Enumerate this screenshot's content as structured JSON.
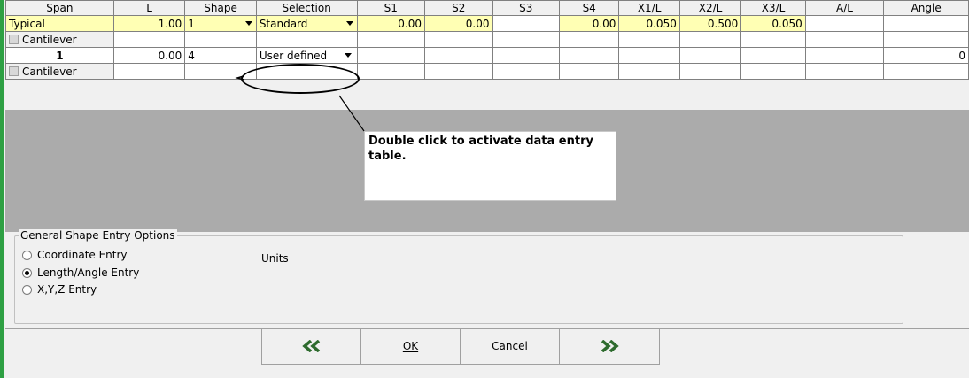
{
  "columns": [
    "Span",
    "L",
    "Shape",
    "Selection",
    "S1",
    "S2",
    "S3",
    "S4",
    "X1/L",
    "X2/L",
    "X3/L",
    "A/L",
    "Angle"
  ],
  "rows": {
    "typical": {
      "span": "Typical",
      "l": "1.00",
      "shape": "1",
      "selection": "Standard",
      "s1": "0.00",
      "s2": "0.00",
      "s3": "",
      "s4": "0.00",
      "x1": "0.050",
      "x2": "0.500",
      "x3": "0.050",
      "a": "",
      "angle": ""
    },
    "cant1": {
      "label": "Cantilever"
    },
    "span1": {
      "span": "1",
      "l": "0.00",
      "shape": "4",
      "selection": "User defined",
      "angle": "0"
    },
    "cant2": {
      "label": "Cantilever"
    }
  },
  "callout": {
    "text": "Double click to activate data entry table."
  },
  "options": {
    "legend": "General Shape Entry Options",
    "coordinate": "Coordinate Entry",
    "length_angle": "Length/Angle Entry",
    "xyz": "X,Y,Z Entry",
    "selected": "length_angle",
    "units_label": "Units"
  },
  "buttons": {
    "prev": "«",
    "ok": "OK",
    "cancel": "Cancel",
    "next": "»"
  },
  "colors": {
    "highlight": "#ffffb4",
    "gray_area": "#ababab",
    "accent_green": "#2ea043",
    "arrow_green": "#2e6b2e"
  }
}
